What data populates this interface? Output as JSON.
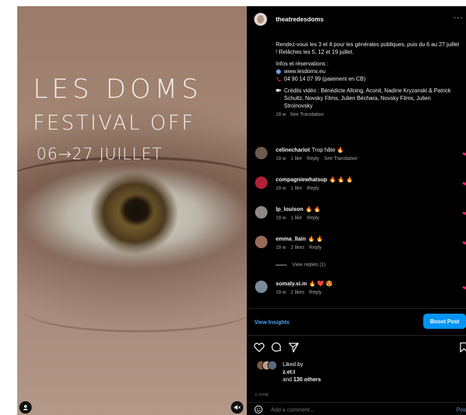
{
  "poster": {
    "line1": "LES DOMS",
    "line2": "FESTIVAL OFF",
    "line3": "06→27 JUILLET"
  },
  "post": {
    "username": "theatredesdoms",
    "more_icon": "···",
    "caption": {
      "para1": "Rendez-vous les 3 et 4 pour les générales publiques, puis du 6 au 27 juillet ! Relâches les 5, 12 et 19 juillet.",
      "info_heading": "Infos et réservations :",
      "website": "www.lesdoms.eu",
      "phone": "04 90 14 07 99 (paiement en CB)",
      "credits": "Crédits vidéo : Bénédicte Alloing, Aconit, Nadine Kryzanski & Patrick Schultz, Novsky Films, Julien Béchara, Novsky Films, Julien Stroinovsky",
      "age": "19 w",
      "see_translation": "See Translation"
    },
    "comments": [
      {
        "user": "celinechariot",
        "text": "Trop hâte",
        "emoji": "🔥",
        "age": "19 w",
        "likes": "1 like",
        "reply": "Reply",
        "translation": "See Translation",
        "avatar_color": "#6b5a4e"
      },
      {
        "user": "compagniewhatsup",
        "text": "",
        "emoji": "🔥 🔥 🔥",
        "age": "19 w",
        "likes": "1 like",
        "reply": "Reply",
        "translation": "",
        "avatar_color": "#b3203a"
      },
      {
        "user": "lp_louison",
        "text": "",
        "emoji": "🔥 🔥",
        "age": "19 w",
        "likes": "1 like",
        "reply": "Reply",
        "translation": "",
        "avatar_color": "#8d8a86"
      },
      {
        "user": "emma_llain",
        "text": "",
        "emoji": "🔥 🔥",
        "age": "19 w",
        "likes": "2 likes",
        "reply": "Reply",
        "translation": "",
        "avatar_color": "#9a6a58"
      },
      {
        "user": "somaly.si.m",
        "text": "",
        "emoji": "🔥 ❤️ 😍",
        "age": "19 w",
        "likes": "2 likes",
        "reply": "Reply",
        "translation": "",
        "avatar_color": "#7a8a9a"
      }
    ],
    "view_replies": "View replies (1)",
    "view_insights": "View Insights",
    "boost_post": "Boost Post",
    "liked_by": "Liked by",
    "liked_user": "z.et.t",
    "liked_others_prefix": "and",
    "liked_others": "130 others",
    "date": "2 JUNE",
    "add_comment_placeholder": "Add a comment...",
    "post_label": "Post"
  },
  "colors": {
    "accent": "#0095f6",
    "insights_link": "#4fa3f7",
    "like_heart": "#e0245e",
    "fire_emoji": "#f29b1d"
  }
}
